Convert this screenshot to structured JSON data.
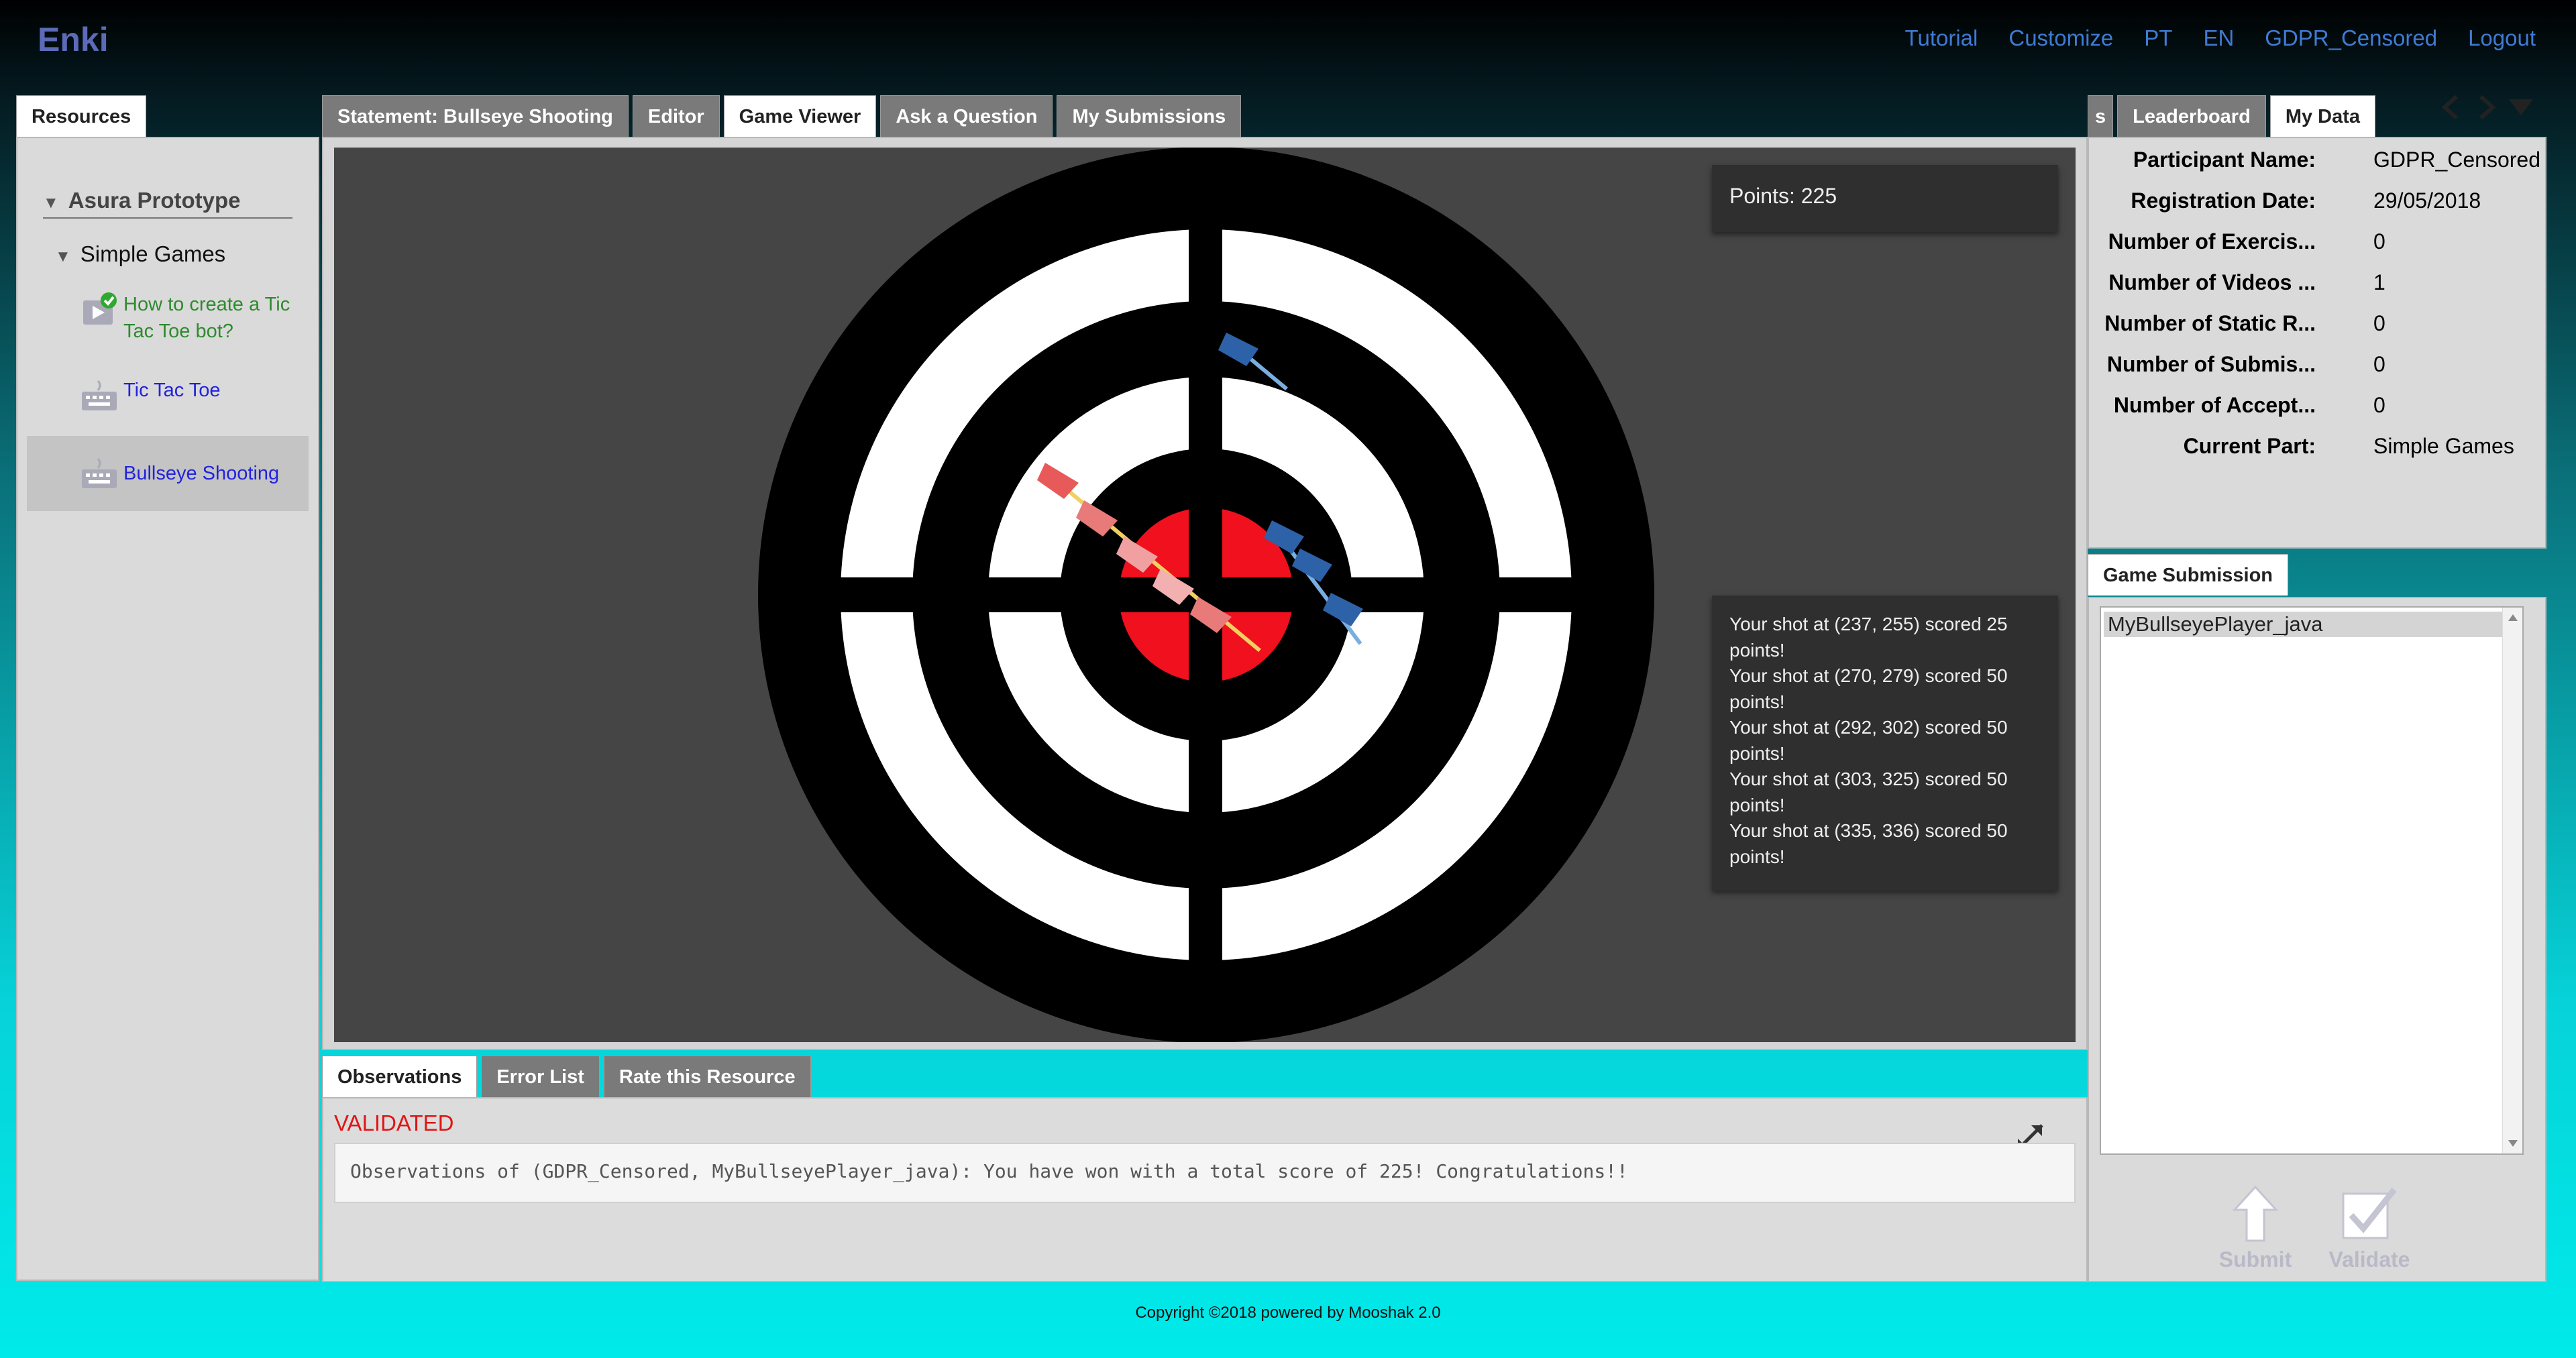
{
  "brand": "Enki",
  "topnav": [
    "Tutorial",
    "Customize",
    "PT",
    "EN",
    "GDPR_Censored",
    "Logout"
  ],
  "resources": {
    "tab": "Resources",
    "root": "Asura Prototype",
    "group": "Simple Games",
    "items": [
      {
        "label": "How to create a Tic Tac Toe bot?",
        "icon": "video-icon",
        "status": "completed-check-icon",
        "color": "#2e8b2e"
      },
      {
        "label": "Tic Tac Toe",
        "icon": "keyboard-icon",
        "color": "#2222dd"
      },
      {
        "label": "Bullseye Shooting",
        "icon": "keyboard-icon",
        "color": "#2222dd",
        "selected": true
      }
    ]
  },
  "center_tabs": [
    "Statement: Bullseye Shooting",
    "Editor",
    "Game Viewer",
    "Ask a Question",
    "My Submissions"
  ],
  "center_active": "Game Viewer",
  "game": {
    "points": "Points: 225",
    "log": [
      "Your shot at (237, 255) scored 25 points!",
      "Your shot at (270, 279) scored 50 points!",
      "Your shot at (292, 302) scored 50 points!",
      "Your shot at (303, 325) scored 50 points!",
      "Your shot at (335, 336) scored 50 points!"
    ]
  },
  "bottom_tabs": [
    "Observations",
    "Error List",
    "Rate this Resource"
  ],
  "bottom_active": "Observations",
  "observations": {
    "status": "VALIDATED",
    "text": "Observations of (GDPR_Censored, MyBullseyePlayer_java): You have won with a total score of 225! Congratulations!!"
  },
  "right_tabs": [
    "s",
    "Leaderboard",
    "My Data"
  ],
  "right_active": "My Data",
  "my_data": [
    {
      "key": "Participant Name:",
      "value": "GDPR_Censored"
    },
    {
      "key": "Registration Date:",
      "value": "29/05/2018"
    },
    {
      "key": "Number of Exercis...",
      "value": "0"
    },
    {
      "key": "Number of Videos ...",
      "value": "1"
    },
    {
      "key": "Number of Static R...",
      "value": "0"
    },
    {
      "key": "Number of Submis...",
      "value": "0"
    },
    {
      "key": "Number of Accept...",
      "value": "0"
    },
    {
      "key": "Current Part:",
      "value": "Simple Games"
    }
  ],
  "submission": {
    "tab": "Game Submission",
    "items": [
      "MyBullseyePlayer_java"
    ],
    "submit": "Submit",
    "validate": "Validate"
  },
  "footer": "Copyright ©2018 powered by Mooshak 2.0"
}
